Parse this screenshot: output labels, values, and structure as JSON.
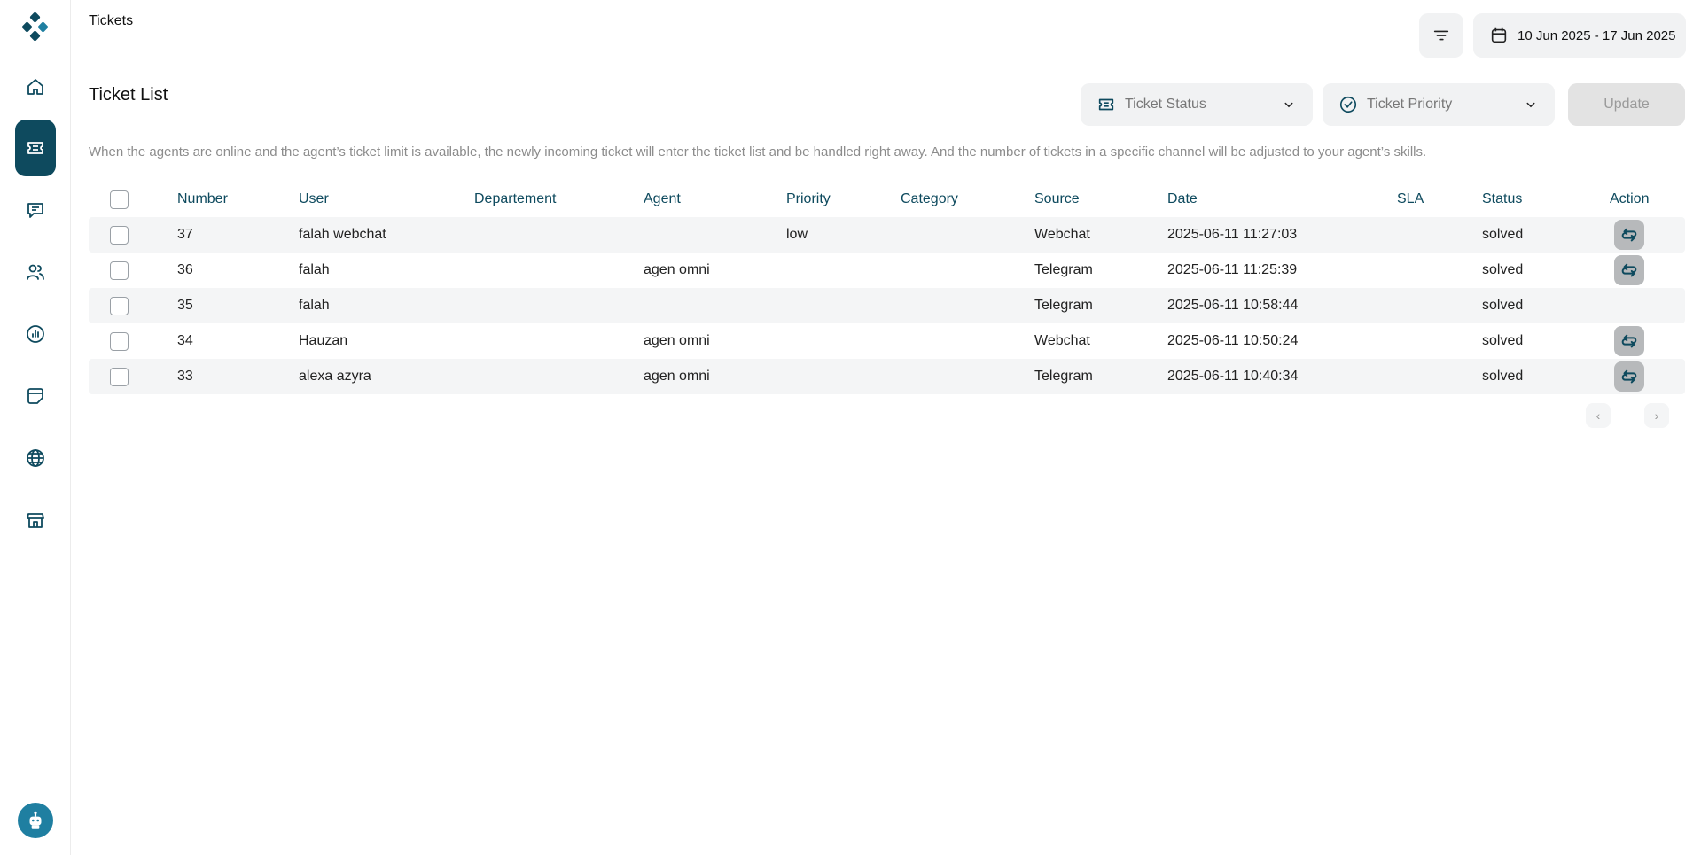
{
  "header": {
    "title": "Tickets",
    "date_range": "10 Jun 2025 - 17 Jun 2025"
  },
  "section": {
    "title": "Ticket List",
    "description": "When the agents are online and the agent’s ticket limit is available, the newly incoming ticket will enter the ticket list and be handled right away. And the number of tickets in a specific channel will be adjusted to your agent’s skills."
  },
  "filters": {
    "status_placeholder": "Ticket Status",
    "priority_placeholder": "Ticket Priority",
    "update_label": "Update"
  },
  "sidebar": {
    "items": [
      {
        "name": "home-icon",
        "active": false
      },
      {
        "name": "ticket-icon",
        "active": true
      },
      {
        "name": "chat-icon",
        "active": false
      },
      {
        "name": "users-icon",
        "active": false
      },
      {
        "name": "report-icon",
        "active": false
      },
      {
        "name": "sticker-icon",
        "active": false
      },
      {
        "name": "globe-icon",
        "active": false
      },
      {
        "name": "store-icon",
        "active": false
      }
    ]
  },
  "table": {
    "headers": {
      "number": "Number",
      "user": "User",
      "department": "Departement",
      "agent": "Agent",
      "priority": "Priority",
      "category": "Category",
      "source": "Source",
      "date": "Date",
      "sla": "SLA",
      "status": "Status",
      "action": "Action"
    },
    "rows": [
      {
        "number": "37",
        "user": "falah webchat",
        "department": "",
        "agent": "",
        "priority": "low",
        "category": "",
        "source": "Webchat",
        "date": "2025-06-11 11:27:03",
        "sla": "",
        "status": "solved",
        "has_action": true
      },
      {
        "number": "36",
        "user": "falah",
        "department": "",
        "agent": "agen omni",
        "priority": "",
        "category": "",
        "source": "Telegram",
        "date": "2025-06-11 11:25:39",
        "sla": "",
        "status": "solved",
        "has_action": true
      },
      {
        "number": "35",
        "user": "falah",
        "department": "",
        "agent": "",
        "priority": "",
        "category": "",
        "source": "Telegram",
        "date": "2025-06-11 10:58:44",
        "sla": "",
        "status": "solved",
        "has_action": false
      },
      {
        "number": "34",
        "user": "Hauzan",
        "department": "",
        "agent": "agen omni",
        "priority": "",
        "category": "",
        "source": "Webchat",
        "date": "2025-06-11 10:50:24",
        "sla": "",
        "status": "solved",
        "has_action": true
      },
      {
        "number": "33",
        "user": "alexa azyra",
        "department": "",
        "agent": "agen omni",
        "priority": "",
        "category": "",
        "source": "Telegram",
        "date": "2025-06-11 10:40:34",
        "sla": "",
        "status": "solved",
        "has_action": true
      }
    ]
  },
  "pagination": {
    "prev": "‹",
    "next": "›"
  },
  "colors": {
    "accent": "#0e4a5e",
    "avatar": "#1f7fa1"
  }
}
